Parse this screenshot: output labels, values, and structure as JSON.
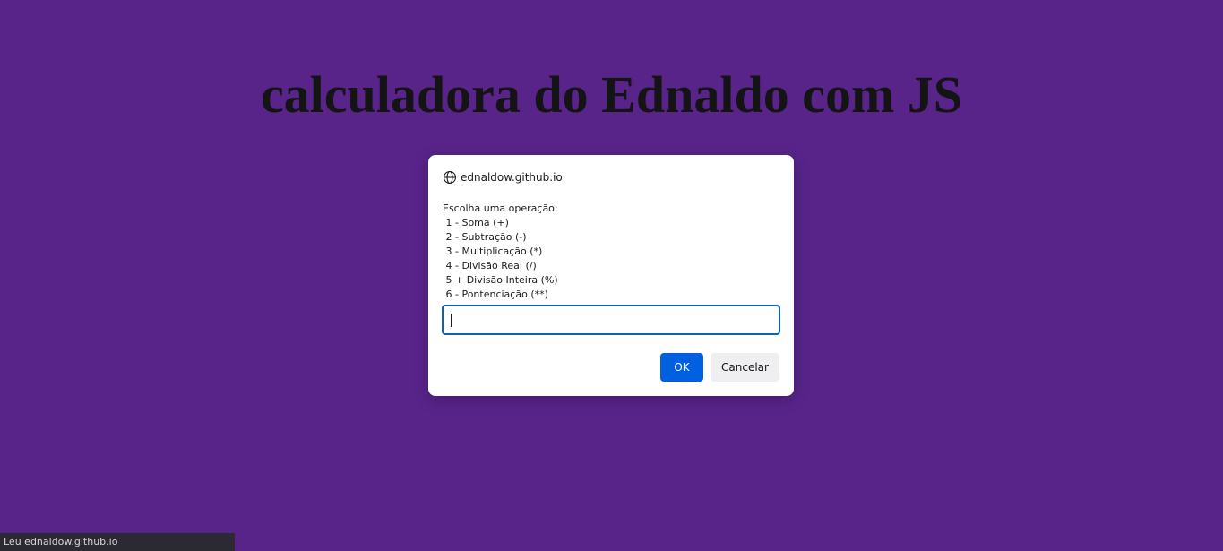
{
  "page": {
    "title": "calculadora do Ednaldo com JS",
    "background_color": "#58248a"
  },
  "dialog": {
    "origin": "ednaldow.github.io",
    "origin_icon": "globe-icon",
    "message_lines": [
      "Escolha uma operação:",
      " 1 - Soma (+)",
      " 2 - Subtração (-)",
      " 3 - Multiplicação (*)",
      " 4 - Divisão Real (/)",
      " 5 + Divisão Inteira (%)",
      " 6 - Pontenciação (**)"
    ],
    "input_value": "",
    "ok_label": "OK",
    "cancel_label": "Cancelar",
    "accent_color": "#0060df"
  },
  "status_bar": {
    "text": "Leu ednaldow.github.io"
  }
}
